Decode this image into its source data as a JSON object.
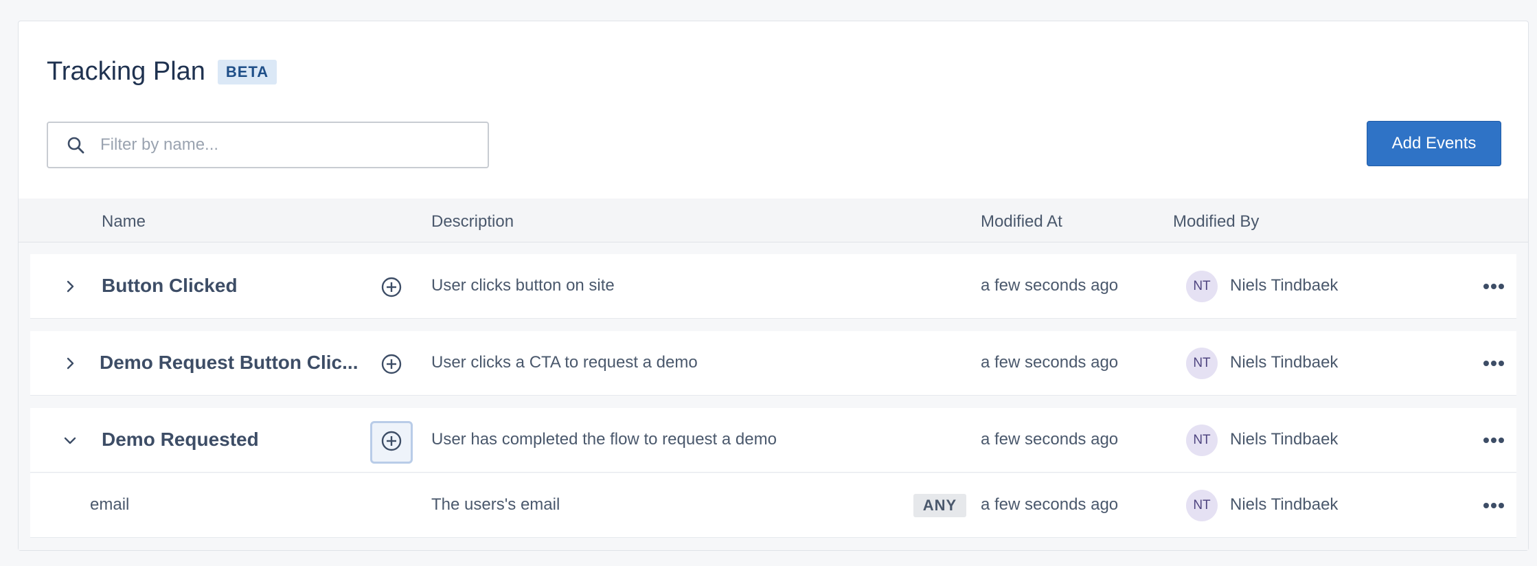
{
  "header": {
    "title": "Tracking Plan",
    "badge": "BETA"
  },
  "search": {
    "placeholder": "Filter by name...",
    "value": ""
  },
  "toolbar": {
    "add_events_label": "Add Events"
  },
  "table": {
    "columns": [
      "Name",
      "Description",
      "Modified At",
      "Modified By"
    ],
    "events": [
      {
        "name": "Button Clicked",
        "description": "User clicks button on site",
        "modified_at": "a few seconds ago",
        "modified_by_initials": "NT",
        "modified_by": "Niels Tindbaek",
        "expanded": false
      },
      {
        "name": "Demo Request Button Clic...",
        "description": "User clicks a CTA to request a demo",
        "modified_at": "a few seconds ago",
        "modified_by_initials": "NT",
        "modified_by": "Niels Tindbaek",
        "expanded": false
      },
      {
        "name": "Demo Requested",
        "description": "User has completed the flow to request a demo",
        "modified_at": "a few seconds ago",
        "modified_by_initials": "NT",
        "modified_by": "Niels Tindbaek",
        "expanded": true,
        "properties": [
          {
            "name": "email",
            "description": "The users's email",
            "type": "ANY",
            "modified_at": "a few seconds ago",
            "modified_by_initials": "NT",
            "modified_by": "Niels Tindbaek"
          }
        ]
      }
    ]
  },
  "icons": {
    "search": "search-icon",
    "expand": "chevron-right-icon",
    "collapse": "chevron-down-icon",
    "add_property": "plus-circle-icon",
    "more": "more-horizontal-icon"
  },
  "colors": {
    "accent": "#2f73c6",
    "badge_bg": "#dbe8f6",
    "avatar_bg": "#e5e1f3"
  }
}
